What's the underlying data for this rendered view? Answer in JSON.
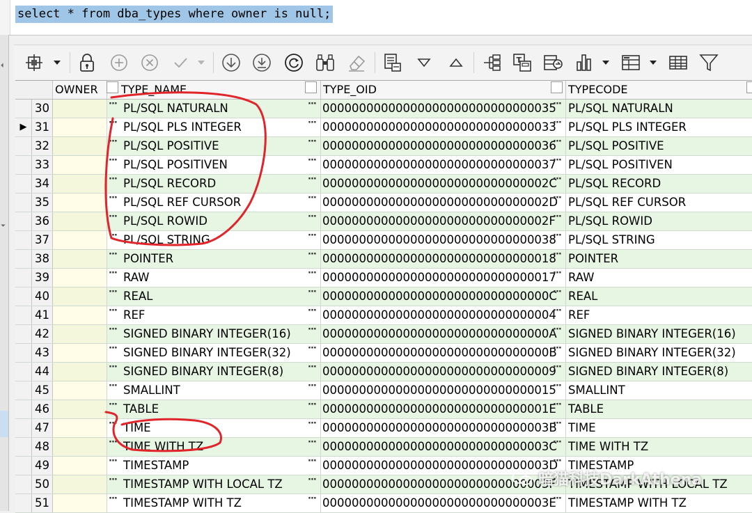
{
  "editor": {
    "sql": "select * from dba_types where owner is null;"
  },
  "toolbar": {
    "icons": [
      "grid-mode-icon",
      "dropdown-arrow-icon",
      "lock-icon",
      "add-row-icon",
      "delete-row-icon",
      "post-changes-icon",
      "dropdown-arrow-icon",
      "fetch-next-icon",
      "fetch-all-icon",
      "refresh-icon",
      "find-icon",
      "clear-icon",
      "export-icon",
      "sort-desc-icon",
      "sort-asc-icon",
      "tree-view-icon",
      "copy-query-icon",
      "export-data-icon",
      "chart-icon",
      "dropdown-arrow-icon",
      "group-icon",
      "dropdown-arrow-icon",
      "table-view-icon",
      "filter-icon"
    ]
  },
  "grid": {
    "columns": [
      "OWNER",
      "TYPE_NAME",
      "TYPE_OID",
      "TYPECODE"
    ],
    "current_row": "31",
    "rows": [
      {
        "num": "30",
        "owner": "",
        "type_name": "PL/SQL NATURALN",
        "type_oid": "00000000000000000000000000000035",
        "typecode": "PL/SQL NATURALN"
      },
      {
        "num": "31",
        "owner": "",
        "type_name": "PL/SQL PLS INTEGER",
        "type_oid": "00000000000000000000000000000033",
        "typecode": "PL/SQL PLS INTEGER"
      },
      {
        "num": "32",
        "owner": "",
        "type_name": "PL/SQL POSITIVE",
        "type_oid": "00000000000000000000000000000036",
        "typecode": "PL/SQL POSITIVE"
      },
      {
        "num": "33",
        "owner": "",
        "type_name": "PL/SQL POSITIVEN",
        "type_oid": "00000000000000000000000000000037",
        "typecode": "PL/SQL POSITIVEN"
      },
      {
        "num": "34",
        "owner": "",
        "type_name": "PL/SQL RECORD",
        "type_oid": "0000000000000000000000000000002C",
        "typecode": "PL/SQL RECORD"
      },
      {
        "num": "35",
        "owner": "",
        "type_name": "PL/SQL REF CURSOR",
        "type_oid": "0000000000000000000000000000002D",
        "typecode": "PL/SQL REF CURSOR"
      },
      {
        "num": "36",
        "owner": "",
        "type_name": "PL/SQL ROWID",
        "type_oid": "0000000000000000000000000000002F",
        "typecode": "PL/SQL ROWID"
      },
      {
        "num": "37",
        "owner": "",
        "type_name": "PL/SQL STRING",
        "type_oid": "00000000000000000000000000000038",
        "typecode": "PL/SQL STRING"
      },
      {
        "num": "38",
        "owner": "",
        "type_name": "POINTER",
        "type_oid": "00000000000000000000000000000018",
        "typecode": "POINTER"
      },
      {
        "num": "39",
        "owner": "",
        "type_name": "RAW",
        "type_oid": "00000000000000000000000000000017",
        "typecode": "RAW"
      },
      {
        "num": "40",
        "owner": "",
        "type_name": "REAL",
        "type_oid": "0000000000000000000000000000000C",
        "typecode": "REAL"
      },
      {
        "num": "41",
        "owner": "",
        "type_name": "REF",
        "type_oid": "00000000000000000000000000000004",
        "typecode": "REF"
      },
      {
        "num": "42",
        "owner": "",
        "type_name": "SIGNED BINARY INTEGER(16)",
        "type_oid": "0000000000000000000000000000000A",
        "typecode": "SIGNED BINARY INTEGER(16)"
      },
      {
        "num": "43",
        "owner": "",
        "type_name": "SIGNED BINARY INTEGER(32)",
        "type_oid": "0000000000000000000000000000000B",
        "typecode": "SIGNED BINARY INTEGER(32)"
      },
      {
        "num": "44",
        "owner": "",
        "type_name": "SIGNED BINARY INTEGER(8)",
        "type_oid": "00000000000000000000000000000009",
        "typecode": "SIGNED BINARY INTEGER(8)"
      },
      {
        "num": "45",
        "owner": "",
        "type_name": "SMALLINT",
        "type_oid": "00000000000000000000000000000015",
        "typecode": "SMALLINT"
      },
      {
        "num": "46",
        "owner": "",
        "type_name": "TABLE",
        "type_oid": "0000000000000000000000000000001E",
        "typecode": "TABLE"
      },
      {
        "num": "47",
        "owner": "",
        "type_name": "TIME",
        "type_oid": "0000000000000000000000000000003B",
        "typecode": "TIME"
      },
      {
        "num": "48",
        "owner": "",
        "type_name": "TIME WITH TZ",
        "type_oid": "0000000000000000000000000000003C",
        "typecode": "TIME WITH TZ"
      },
      {
        "num": "49",
        "owner": "",
        "type_name": "TIMESTAMP",
        "type_oid": "0000000000000000000000000000003D",
        "typecode": "TIMESTAMP"
      },
      {
        "num": "50",
        "owner": "",
        "type_name": "TIMESTAMP WITH LOCAL TZ",
        "type_oid": "0000000000000000000000000000003F",
        "typecode": "TIMESTAMP WITH LOCAL TZ"
      },
      {
        "num": "51",
        "owner": "",
        "type_name": "TIMESTAMP WITH TZ",
        "type_oid": "0000000000000000000000000000003E",
        "typecode": "TIMESTAMP WITH TZ"
      }
    ]
  },
  "watermark": {
    "text": "暗猫科技DarkAthena"
  },
  "colors": {
    "row_alt": "#e7f5e3",
    "selection": "#9fc6e6",
    "annotation": "#e0242a"
  }
}
